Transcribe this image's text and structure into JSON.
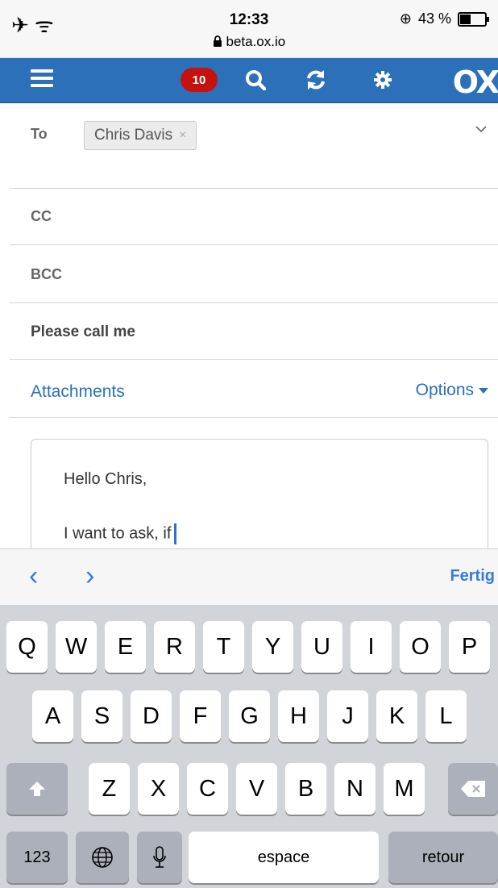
{
  "status_bar": {
    "left_icons": "✈ ᯤ",
    "time": "12:33",
    "url": "beta.ox.io",
    "lock_icon": "lock-icon",
    "orientation_icon": "⊕",
    "battery": "43 %",
    "battery_level": 0.43
  },
  "toolbar": {
    "menu_icon": "hamburger-icon",
    "badge_count": "10",
    "search_icon": "search-icon",
    "refresh_icon": "refresh-icon",
    "settings_icon": "gear-icon",
    "logo": "OX"
  },
  "compose": {
    "to_label": "To",
    "recipient": "Chris Davis",
    "remove_icon": "×",
    "expand_icon": "⌵",
    "cc_label": "CC",
    "bcc_label": "BCC",
    "subject": "Please call me",
    "attachments_label": "Attachments",
    "options_label": "Options",
    "body_line1": "Hello Chris,",
    "body_line2": "I want to ask, if"
  },
  "accessory_bar": {
    "prev_icon": "‹",
    "next_icon": "›",
    "done_label": "Fertig"
  },
  "keyboard": {
    "row1": [
      "Q",
      "W",
      "E",
      "R",
      "T",
      "Y",
      "U",
      "I",
      "O",
      "P"
    ],
    "row2": [
      "A",
      "S",
      "D",
      "F",
      "G",
      "H",
      "J",
      "K",
      "L"
    ],
    "row3": [
      "Z",
      "X",
      "C",
      "V",
      "B",
      "N",
      "M"
    ],
    "numbers_label": "123",
    "space_label": "espace",
    "return_label": "retour"
  }
}
